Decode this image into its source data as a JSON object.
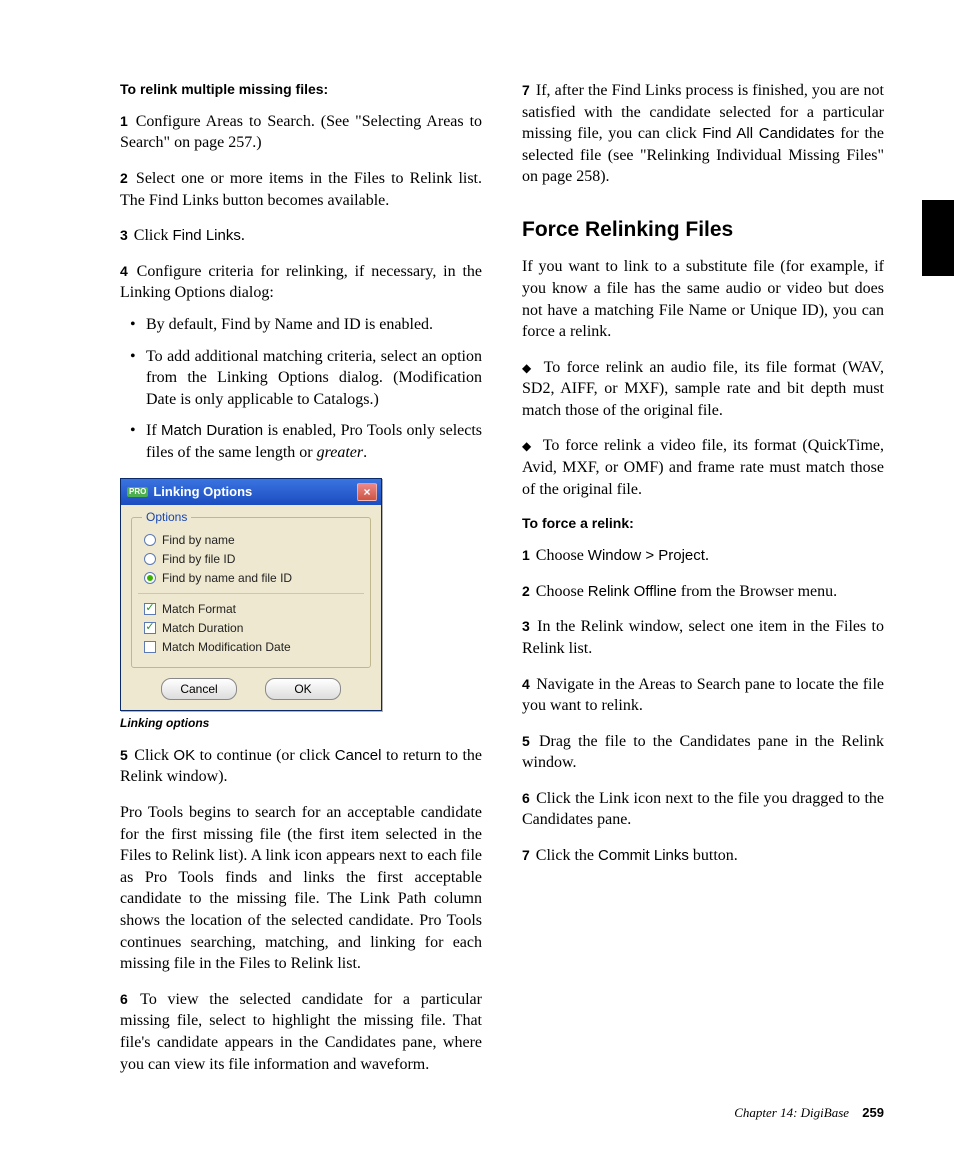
{
  "left": {
    "heading": "To relink multiple missing files:",
    "steps": {
      "s1_num": "1",
      "s1": "Configure Areas to Search. (See \"Selecting Areas to Search\" on page 257.)",
      "s2_num": "2",
      "s2": "Select one or more items in the Files to Relink list. The Find Links button becomes available.",
      "s3_num": "3",
      "s3_pre": "Click ",
      "s3_sans": "Find Links",
      "s3_post": ".",
      "s4_num": "4",
      "s4": "Configure criteria for relinking, if necessary, in the Linking Options dialog:",
      "bullets": {
        "b1": "By default, Find by Name and ID is enabled.",
        "b2": "To add additional matching criteria, select an option from the Linking Options dialog. (Modification Date is only applicable to Catalogs.)",
        "b3_pre": "If ",
        "b3_sans": "Match Duration",
        "b3_mid": " is enabled, Pro Tools only selects files of the same length or ",
        "b3_em": "greater",
        "b3_post": "."
      }
    },
    "dialog": {
      "title": "Linking Options",
      "legend": "Options",
      "radio1": "Find by name",
      "radio2": "Find by file ID",
      "radio3": "Find by name and file ID",
      "check1": "Match Format",
      "check2": "Match Duration",
      "check3": "Match Modification Date",
      "cancel": "Cancel",
      "ok": "OK",
      "caption": "Linking options"
    },
    "after": {
      "s5_num": "5",
      "s5_pre": "Click ",
      "s5_sans1": "OK",
      "s5_mid": " to continue (or click ",
      "s5_sans2": "Cancel",
      "s5_post": " to return to the Relink window).",
      "para": "Pro Tools begins to search for an acceptable candidate for the first missing file (the first item selected in the Files to Relink list). A link icon appears next to each file as Pro Tools finds and links the first acceptable candidate to the missing file. The Link Path column shows the location of the selected candidate. Pro Tools continues searching, matching, and linking for each missing file in the Files to Relink list."
    }
  },
  "right": {
    "s6_num": "6",
    "s6": "To view the selected candidate for a particular missing file, select to highlight the missing file. That file's candidate appears in the Candidates pane, where you can view its file information and waveform.",
    "s7_num": "7",
    "s7_pre": "If, after the Find Links process is finished, you are not satisfied with the candidate selected for a particular missing file, you can click ",
    "s7_sans": "Find All Candidates",
    "s7_post": " for the selected file (see \"Relinking Individual Missing Files\" on page 258).",
    "subhead": "Force Relinking Files",
    "intro": "If you want to link to a substitute file (for example, if you know a file has the same audio or video but does not have a matching File Name or Unique ID), you can force a relink.",
    "d1": "To force relink an audio file, its file format (WAV, SD2, AIFF, or MXF), sample rate and bit depth must match those of the original file.",
    "d2": "To force relink a video file, its format (QuickTime, Avid, MXF, or OMF) and frame rate must match those of the original file.",
    "forceHead": "To force a relink:",
    "fs1_num": "1",
    "fs1_pre": "Choose ",
    "fs1_sans": "Window > Project",
    "fs1_post": ".",
    "fs2_num": "2",
    "fs2_pre": "Choose ",
    "fs2_sans": "Relink Offline",
    "fs2_post": " from the Browser menu.",
    "fs3_num": "3",
    "fs3": "In the Relink window, select one item in the Files to Relink list.",
    "fs4_num": "4",
    "fs4": "Navigate in the Areas to Search pane to locate the file you want to relink.",
    "fs5_num": "5",
    "fs5": "Drag the file to the Candidates pane in the Relink window.",
    "fs6_num": "6",
    "fs6": "Click the Link icon next to the file you dragged to the Candidates pane.",
    "fs7_num": "7",
    "fs7_pre": "Click the ",
    "fs7_sans": "Commit Links",
    "fs7_post": " button."
  },
  "footer": {
    "chapter": "Chapter 14: DigiBase",
    "page": "259"
  }
}
